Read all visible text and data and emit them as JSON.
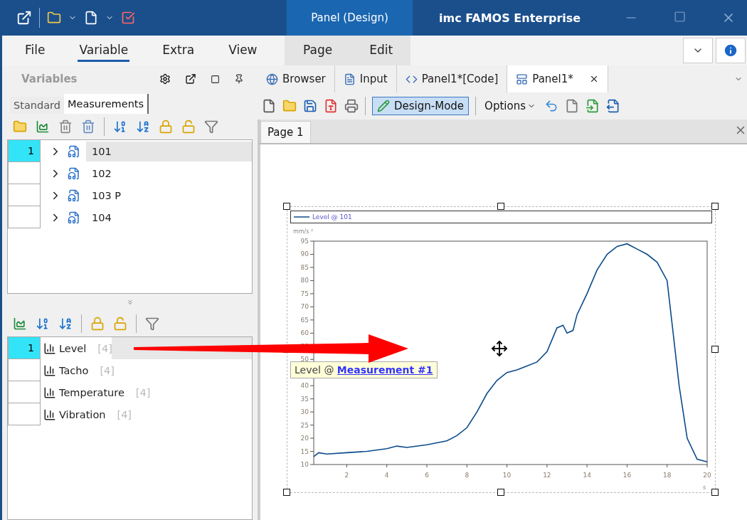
{
  "title_bar": {
    "context_tab": "Panel (Design)",
    "title": "imc FAMOS Enterprise"
  },
  "menu": [
    {
      "label": "File",
      "selected": false,
      "contextual": false
    },
    {
      "label": "Variable",
      "selected": true,
      "contextual": false
    },
    {
      "label": "Extra",
      "selected": false,
      "contextual": false
    },
    {
      "label": "View",
      "selected": false,
      "contextual": false
    },
    {
      "label": "Page",
      "selected": false,
      "contextual": true
    },
    {
      "label": "Edit",
      "selected": false,
      "contextual": true
    }
  ],
  "variables_panel": {
    "title": "Variables",
    "tabs": [
      {
        "label": "Standard",
        "selected": false
      },
      {
        "label": "Measurements",
        "selected": true
      }
    ],
    "measurements": [
      {
        "number": "1",
        "label": "101",
        "selected": true
      },
      {
        "label": "102",
        "selected": false
      },
      {
        "label": "103 P",
        "selected": false
      },
      {
        "label": "104",
        "selected": false
      }
    ],
    "channels": [
      {
        "number": "1",
        "label": "Level",
        "count": "[4]",
        "selected": true
      },
      {
        "label": "Tacho",
        "count": "[4]",
        "selected": false
      },
      {
        "label": "Temperature",
        "count": "[4]",
        "selected": false
      },
      {
        "label": "Vibration",
        "count": "[4]",
        "selected": false
      }
    ]
  },
  "doc_tabs": [
    {
      "label": "Browser",
      "selected": false,
      "kind": "browser"
    },
    {
      "label": "Input",
      "selected": false,
      "kind": "input"
    },
    {
      "label": "Panel1*[Code]",
      "selected": false,
      "kind": "code"
    },
    {
      "label": "Panel1*",
      "selected": true,
      "kind": "panel"
    }
  ],
  "toolbar": {
    "design_mode": {
      "label": "Design-Mode",
      "on": true
    },
    "options": "Options"
  },
  "page_tabs": [
    {
      "label": "Page 1",
      "selected": true
    }
  ],
  "chart": {
    "tooltip": {
      "text": "Level @",
      "link": "Measurement #1"
    },
    "chart_data": {
      "type": "line",
      "ylabel": "mm/s ²",
      "xlabel": "s",
      "x": [
        0.35,
        0.6,
        1,
        2,
        3,
        4,
        4.5,
        5,
        6,
        7,
        7.5,
        8,
        8.5,
        9,
        9.5,
        10,
        10.5,
        11,
        11.5,
        12,
        12.5,
        12.8,
        13,
        13.3,
        13.5,
        14,
        14.5,
        15,
        15.5,
        16,
        16.5,
        17,
        17.5,
        18,
        18.3,
        18.6,
        19,
        19.5,
        20
      ],
      "series": [
        {
          "name": "Level @ 101",
          "color": "#0b4a8a",
          "values": [
            13,
            14.5,
            14,
            14.5,
            15,
            16,
            17,
            16.5,
            17.5,
            19,
            21,
            24,
            30,
            37,
            42,
            45,
            46,
            47.5,
            49,
            53,
            62,
            63,
            60,
            61,
            67,
            75,
            84,
            90,
            93,
            94,
            92,
            90,
            87,
            80,
            60,
            40,
            20,
            12,
            11
          ]
        }
      ],
      "xlim": [
        0.35,
        20
      ],
      "ylim": [
        10,
        95
      ],
      "xticks": [
        2,
        4,
        6,
        8,
        10,
        12,
        14,
        16,
        18,
        20
      ],
      "yticks": [
        10,
        15,
        20,
        25,
        30,
        35,
        40,
        50,
        55,
        60,
        65,
        70,
        75,
        80,
        85,
        90,
        95
      ]
    }
  }
}
